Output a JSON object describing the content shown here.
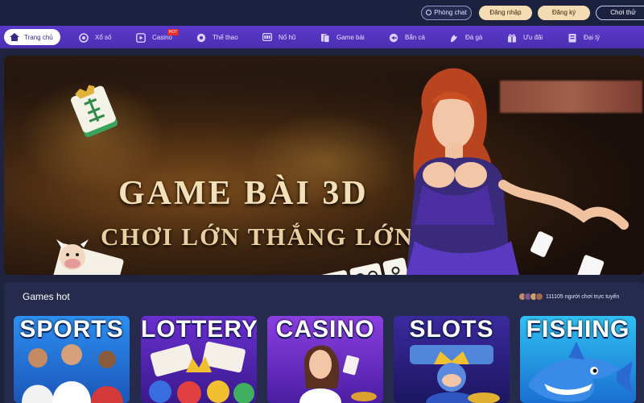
{
  "header": {
    "chat_label": "Phòng chat",
    "login_label": "Đăng nhập",
    "register_label": "Đăng ký",
    "trial_label": "Chơi thử"
  },
  "nav": {
    "items": [
      {
        "label": "Trang chủ",
        "icon": "home-icon"
      },
      {
        "label": "Xổ số",
        "icon": "lottery-ball-icon"
      },
      {
        "label": "Casino",
        "icon": "play-icon",
        "badge": "HOT"
      },
      {
        "label": "Thể thao",
        "icon": "soccer-ball-icon"
      },
      {
        "label": "Nổ hũ",
        "icon": "slot-machine-icon"
      },
      {
        "label": "Game bài",
        "icon": "cards-icon"
      },
      {
        "label": "Bắn cá",
        "icon": "fish-icon"
      },
      {
        "label": "Đá gà",
        "icon": "rooster-icon"
      },
      {
        "label": "Ưu đãi",
        "icon": "gift-icon"
      },
      {
        "label": "Đại lý",
        "icon": "agent-icon"
      }
    ]
  },
  "banner": {
    "title_line1": "GAME BÀI 3D",
    "title_line2": "CHƠI LỚN THẮNG LỚN"
  },
  "games_hot": {
    "title": "Games hot",
    "online_count_text": "111105 người chơi trực tuyến",
    "cards": [
      {
        "label": "SPORTS"
      },
      {
        "label": "LOTTERY"
      },
      {
        "label": "CASINO"
      },
      {
        "label": "SLOTS"
      },
      {
        "label": "FISHING"
      }
    ]
  },
  "colors": {
    "nav_bg": "#5b39c9",
    "topbar_bg": "#1d2140",
    "accent_gold": "#f3dcb2"
  }
}
